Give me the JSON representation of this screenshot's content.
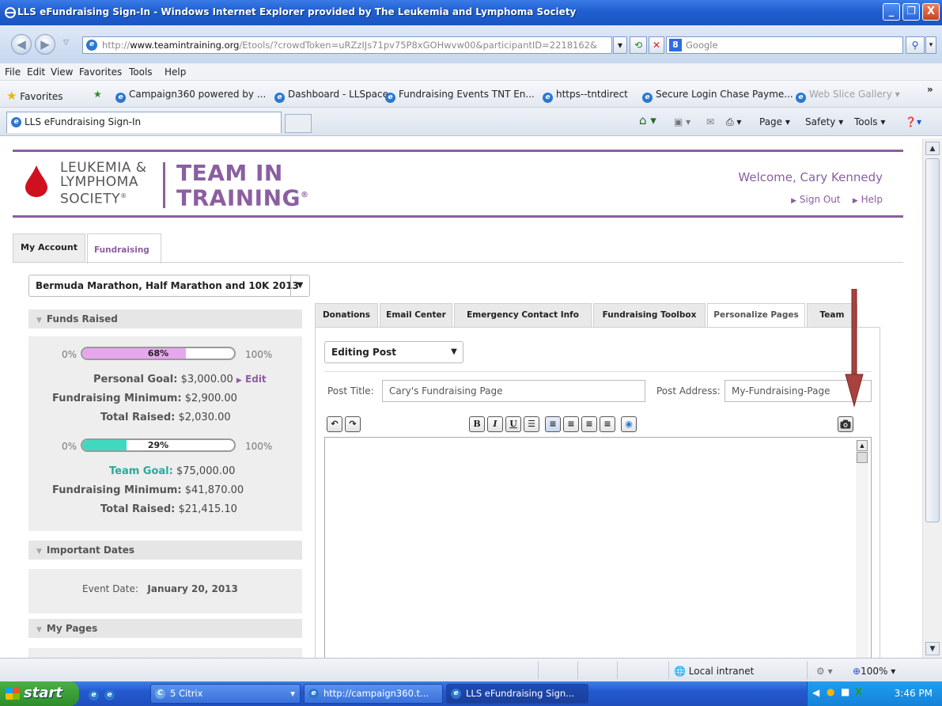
{
  "window": {
    "title": "LLS eFundraising Sign-In - Windows Internet Explorer provided by The Leukemia and Lymphoma Society",
    "buttons": {
      "minimize": "_",
      "restore": "❐",
      "close": "X"
    }
  },
  "addressbar": {
    "url_scheme": "http://",
    "url_host": "www.teamintraining.org",
    "url_path": "/Etools/?crowdToken=uRZzIJs71pv75P8xGOHwvw00&participantID=2218162&",
    "search_placeholder": "Google"
  },
  "menubar": {
    "items": [
      "File",
      "Edit",
      "View",
      "Favorites",
      "Tools",
      "Help"
    ]
  },
  "favorites": {
    "label": "Favorites",
    "items": [
      "Campaign360 powered by ...",
      "Dashboard - LLSpace",
      "Fundraising Events  TNT En...",
      "https--tntdirect",
      "Secure Login  Chase Payme...",
      "Web Slice Gallery"
    ]
  },
  "browser_tab": {
    "title": "LLS eFundraising Sign-In"
  },
  "commands": {
    "page": "Page",
    "safety": "Safety",
    "tools": "Tools"
  },
  "brand": {
    "lls_line1": "LEUKEMIA &",
    "lls_line2": "LYMPHOMA",
    "lls_line3": "SOCIETY",
    "lls_mark": "®",
    "tnt_line1": "TEAM IN",
    "tnt_line2": "TRAINING",
    "tnt_mark": "®"
  },
  "user": {
    "welcome": "Welcome, Cary Kennedy",
    "sign_out": "Sign Out",
    "help": "Help"
  },
  "top_tabs": [
    "My Account",
    "Fundraising"
  ],
  "event_select": {
    "value": "Bermuda Marathon, Half Marathon and 10K 2013"
  },
  "funds": {
    "heading": "Funds Raised",
    "personal": {
      "min_label": "0%",
      "max_label": "100%",
      "percent_label": "68%",
      "percent": 68,
      "goal_label": "Personal Goal:",
      "goal_value": "$3,000.00",
      "edit": "Edit",
      "min_funds_label": "Fundraising Minimum:",
      "min_funds_value": "$2,900.00",
      "raised_label": "Total Raised:",
      "raised_value": "$2,030.00"
    },
    "team": {
      "min_label": "0%",
      "max_label": "100%",
      "percent_label": "29%",
      "percent": 29,
      "goal_label": "Team Goal:",
      "goal_value": "$75,000.00",
      "min_funds_label": "Fundraising Minimum:",
      "min_funds_value": "$41,870.00",
      "raised_label": "Total Raised:",
      "raised_value": "$21,415.10"
    }
  },
  "dates": {
    "heading": "Important Dates",
    "event_label": "Event Date:",
    "event_value": "January 20, 2013"
  },
  "pages": {
    "heading": "My Pages"
  },
  "content_tabs": [
    "Donations",
    "Email Center",
    "Emergency Contact Info",
    "Fundraising Toolbox",
    "Personalize Pages",
    "Team"
  ],
  "editor": {
    "mode": "Editing Post",
    "post_title_label": "Post Title:",
    "post_title_value": "Cary's Fundraising Page",
    "post_address_label": "Post Address:",
    "post_address_value": "My-Fundraising-Page"
  },
  "statusbar": {
    "zone": "Local intranet",
    "zoom": "100%"
  },
  "taskbar": {
    "start": "start",
    "tasks": [
      "5 Citrix",
      "http://campaign360.t...",
      "LLS eFundraising Sign..."
    ],
    "clock": "3:46 PM"
  },
  "colors": {
    "brand_purple": "#8b5ea1",
    "personal_bar": "#e8a6ee",
    "team_bar": "#3fd9c0",
    "annotation_arrow": "#a8423f"
  }
}
